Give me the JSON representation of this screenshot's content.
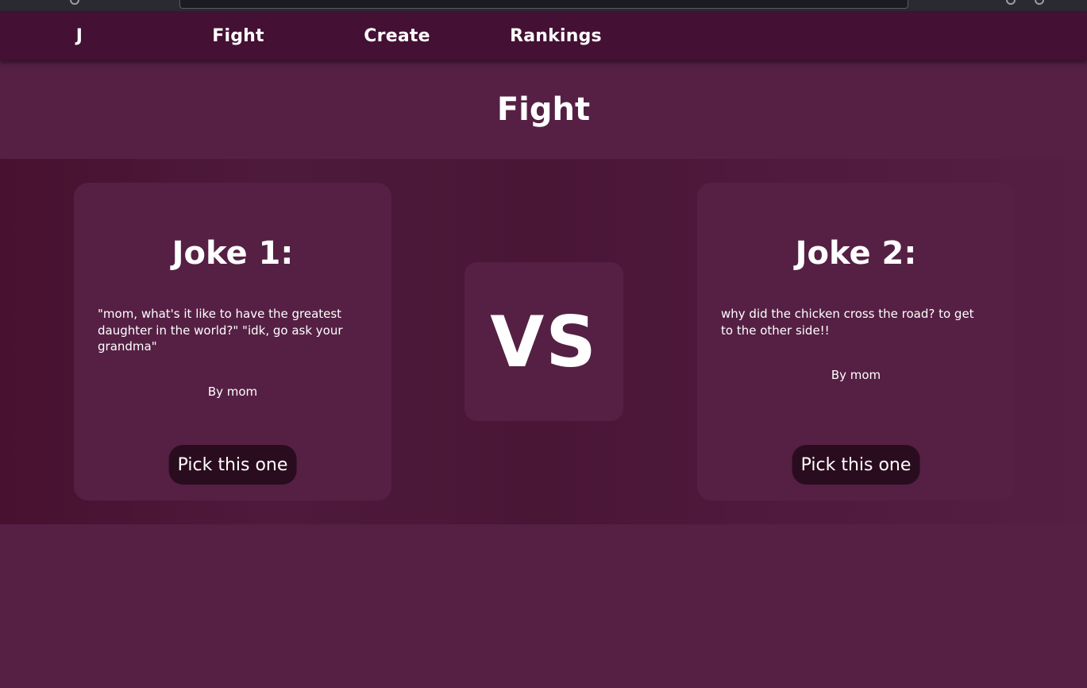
{
  "nav": {
    "brand": "J",
    "items": [
      {
        "label": "Fight"
      },
      {
        "label": "Create"
      },
      {
        "label": "Rankings"
      }
    ]
  },
  "page": {
    "title": "Fight"
  },
  "jokes": [
    {
      "heading": "Joke 1:",
      "text": "\"mom, what's it like to have the greatest daughter in the world?\" \"idk, go ask your grandma\"",
      "author": "By mom",
      "button_label": "Pick this one"
    },
    {
      "heading": "Joke 2:",
      "text": "why did the chicken cross the road? to get to the other side!!",
      "author": "By mom",
      "button_label": "Pick this one"
    }
  ],
  "versus": {
    "label": "VS"
  },
  "colors": {
    "navbar": "#441033",
    "page_background": "#552044",
    "card_background": "#552044",
    "button_background": "#2a0c1f",
    "text": "#ffffff"
  }
}
